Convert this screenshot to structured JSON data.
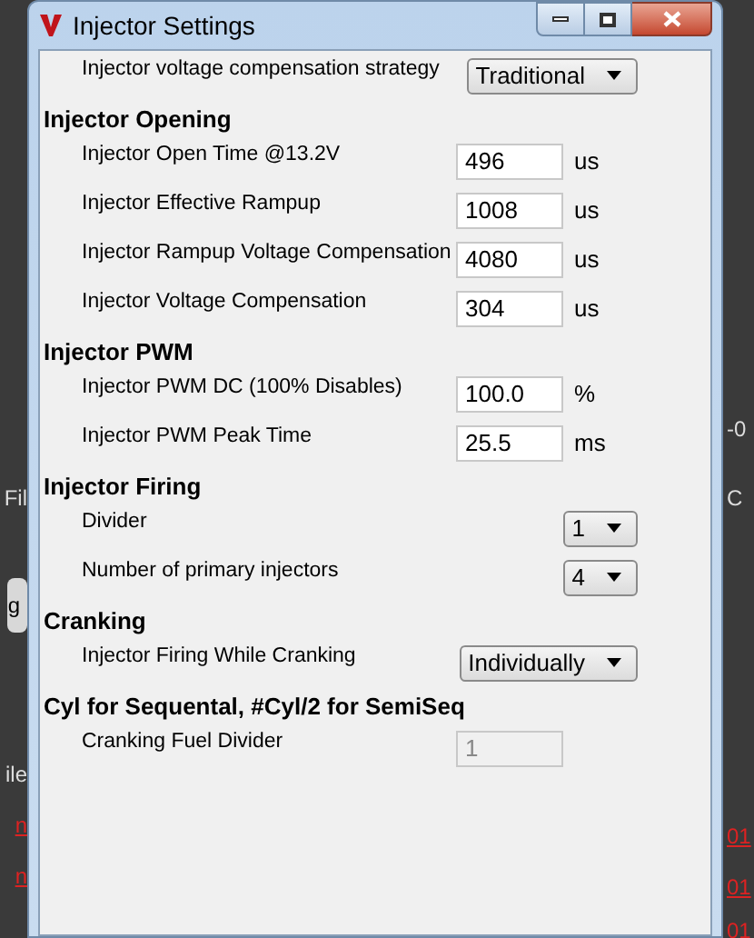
{
  "background": {
    "left_fragments": [
      {
        "text": "Fil",
        "kind": "label"
      },
      {
        "text": "g",
        "kind": "button"
      },
      {
        "text": "ile",
        "kind": "label"
      },
      {
        "text": "n",
        "kind": "link"
      },
      {
        "text": "n",
        "kind": "link"
      }
    ],
    "right_fragments": [
      {
        "text": "-0",
        "kind": "label"
      },
      {
        "text": "C",
        "kind": "label"
      },
      {
        "text": "01",
        "kind": "link"
      },
      {
        "text": "01",
        "kind": "link"
      },
      {
        "text": "01",
        "kind": "link"
      }
    ]
  },
  "window": {
    "title": "Injector Settings"
  },
  "sections": [
    {
      "rows": [
        {
          "label": "Injector voltage compensation strategy",
          "kind": "dropdown",
          "value": "Traditional"
        }
      ]
    },
    {
      "heading": "Injector Opening",
      "rows": [
        {
          "label": "Injector Open Time @13.2V",
          "kind": "input",
          "value": "496",
          "unit": "us",
          "disabled": false
        },
        {
          "label": "Injector Effective Rampup",
          "kind": "input",
          "value": "1008",
          "unit": "us",
          "disabled": false
        },
        {
          "label": "Injector Rampup Voltage Compensation",
          "kind": "input",
          "value": "4080",
          "unit": "us",
          "disabled": false
        },
        {
          "label": "Injector Voltage Compensation",
          "kind": "input",
          "value": "304",
          "unit": "us",
          "disabled": false
        }
      ]
    },
    {
      "heading": "Injector PWM",
      "rows": [
        {
          "label": "Injector PWM DC (100% Disables)",
          "kind": "input",
          "value": "100.0",
          "unit": "%",
          "disabled": false
        },
        {
          "label": "Injector PWM Peak Time",
          "kind": "input",
          "value": "25.5",
          "unit": "ms",
          "disabled": false
        }
      ]
    },
    {
      "heading": "Injector Firing",
      "rows": [
        {
          "label": "Divider",
          "kind": "dropdown",
          "value": "1"
        },
        {
          "label": "Number of primary injectors",
          "kind": "dropdown",
          "value": "4"
        }
      ]
    },
    {
      "heading": "Cranking",
      "rows": [
        {
          "label": "Injector Firing While Cranking",
          "kind": "dropdown",
          "value": "Individually"
        }
      ]
    },
    {
      "heading": "Cyl for Sequental, #Cyl/2 for SemiSeq",
      "rows": [
        {
          "label": "Cranking Fuel Divider",
          "kind": "input",
          "value": "1",
          "disabled": true
        }
      ]
    }
  ]
}
